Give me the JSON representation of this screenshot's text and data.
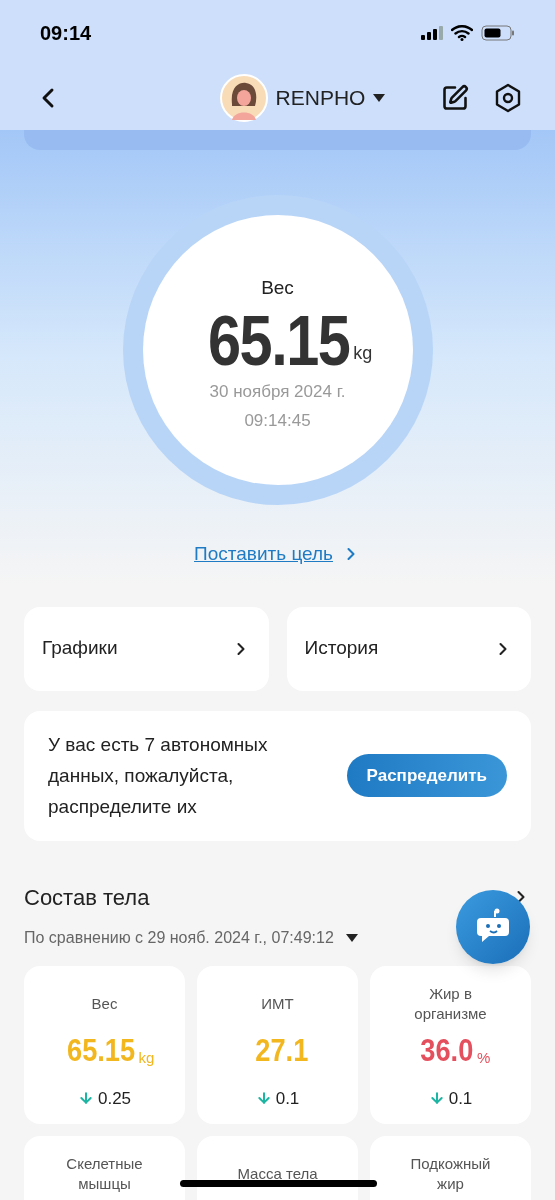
{
  "status_bar": {
    "time": "09:14"
  },
  "nav": {
    "profile_name": "RENPHO"
  },
  "weight": {
    "label": "Вес",
    "value": "65.15",
    "unit": "kg",
    "date": "30 ноября 2024 г.",
    "time": "09:14:45"
  },
  "goal_link": "Поставить цель",
  "shortcuts": [
    "Графики",
    "История"
  ],
  "offline_notice": {
    "text": "У вас есть 7 автономных данных, пожалуйста, распределите их",
    "button": "Распределить"
  },
  "body_composition": {
    "title": "Состав тела",
    "comparison": "По сравнению с 29 нояб. 2024 г., 07:49:12",
    "metrics": [
      {
        "label": "Вес",
        "value": "65.15",
        "unit": "kg",
        "color": "#f2b61f",
        "delta": "0.25",
        "kind": "decrease"
      },
      {
        "label": "ИМТ",
        "value": "27.1",
        "color": "#f2b61f",
        "delta": "0.1",
        "kind": "decrease"
      },
      {
        "label": "Жир в организме",
        "value": "36.0",
        "unit": "%",
        "color": "#e5505e",
        "delta": "0.1",
        "kind": "decrease"
      },
      {
        "label": "Скелетные мышцы"
      },
      {
        "label": "Масса тела"
      },
      {
        "label": "Подкожный жир"
      }
    ]
  }
}
